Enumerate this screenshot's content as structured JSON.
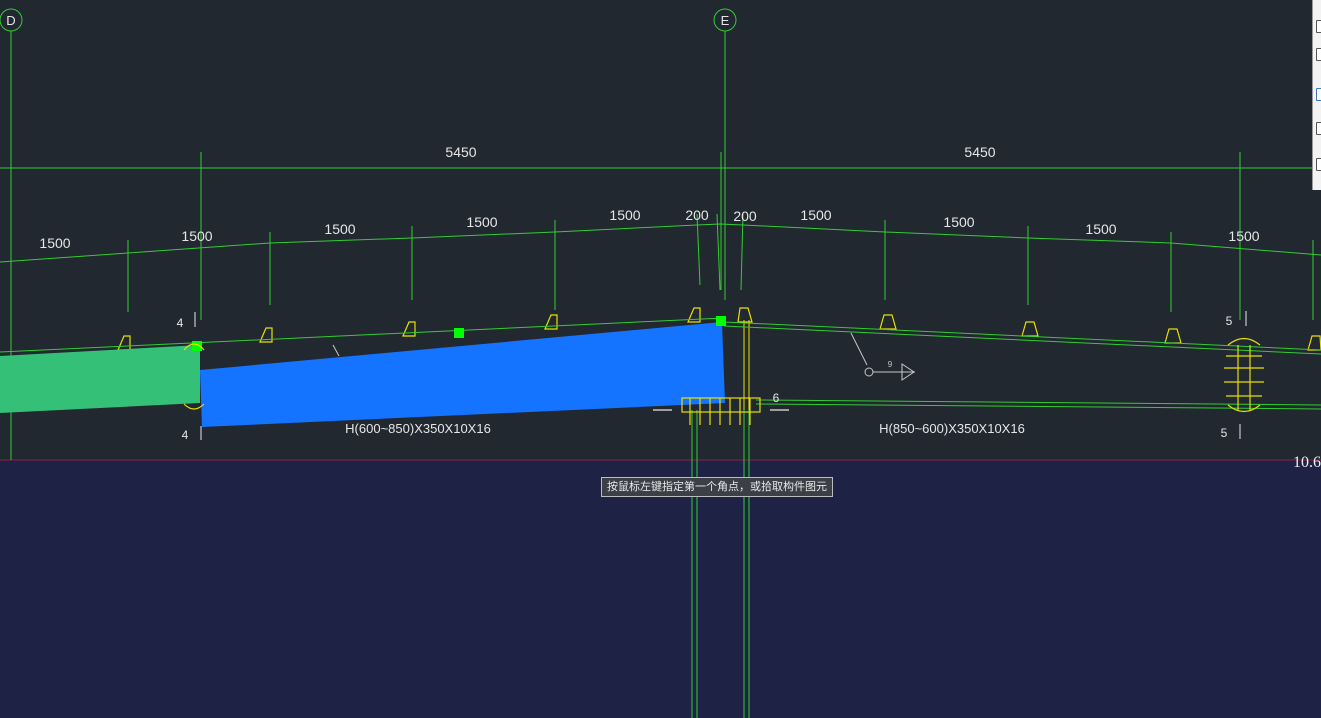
{
  "grid": {
    "axes": [
      {
        "id": "D",
        "label": "D"
      },
      {
        "id": "E",
        "label": "E"
      }
    ],
    "color": "#33cc33"
  },
  "dimensions": {
    "top_row": [
      "5450",
      "5450"
    ],
    "second_row": [
      "1500",
      "1500",
      "1500",
      "1500",
      "1500",
      "200",
      "200",
      "1500",
      "1500",
      "1500",
      "1500"
    ]
  },
  "sections": {
    "left_cut": "4",
    "right_cut": "5",
    "detail": "6",
    "arrow_ref": "9"
  },
  "members": {
    "left_beam": "H(600~850)X350X10X16",
    "right_beam": "H(850~600)X350X10X16"
  },
  "elevation": "10.6",
  "tooltip": "按鼠标左键指定第一个角点，或拾取构件图元",
  "colors": {
    "background": "#212830",
    "lower_area": "#1e2346",
    "selected_blue": "#1473ff",
    "selected_green": "#35c078",
    "grip": "#00ff00",
    "line_green": "#33cc33",
    "line_yellow": "#e8e000",
    "text": "#e6e6e6"
  }
}
